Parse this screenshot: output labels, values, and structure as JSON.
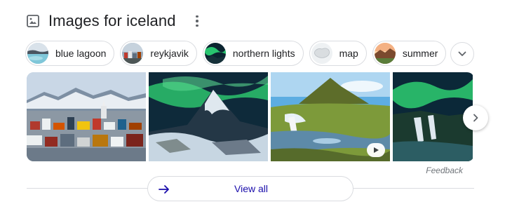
{
  "header": {
    "title": "Images for iceland",
    "icon": "image-icon",
    "menu_icon": "more-vert-icon"
  },
  "chips": [
    {
      "label": "blue lagoon",
      "thumb": "blue-lagoon-thumbnail"
    },
    {
      "label": "reykjavik",
      "thumb": "reykjavik-thumbnail"
    },
    {
      "label": "northern lights",
      "thumb": "northern-lights-thumbnail"
    },
    {
      "label": "map",
      "thumb": "map-thumbnail"
    },
    {
      "label": "summer",
      "thumb": "summer-thumbnail"
    }
  ],
  "chip_expand_icon": "chevron-down-icon",
  "gallery": {
    "images": [
      "reykjavik-city",
      "aurora-kirkjufell",
      "kirkjufell-waterfall",
      "aurora-waterfall"
    ],
    "video_badge_icon": "play-icon",
    "next_icon": "chevron-right-icon"
  },
  "feedback_label": "Feedback",
  "view_all": {
    "label": "View all",
    "icon": "arrow-right-icon"
  },
  "colors": {
    "link": "#1a0dab",
    "border": "#dadce0",
    "text": "#202124",
    "muted": "#70757a",
    "arrow": "#1a0dab"
  }
}
